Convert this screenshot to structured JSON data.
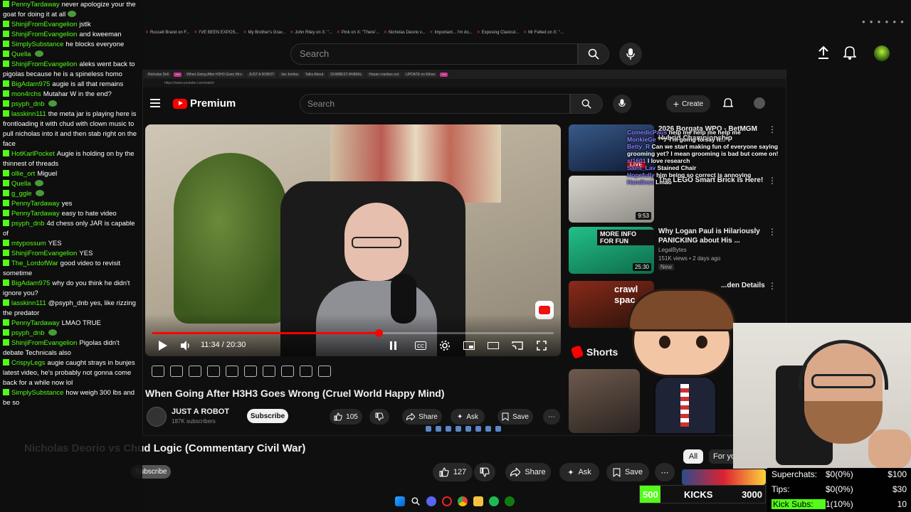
{
  "colors": {
    "kick_green": "#53fc18",
    "youtube_red": "#ff0000",
    "bg": "#0f0f0f"
  },
  "outer_browser": {
    "tabs": [
      "Russell Brand on F...",
      "I'VE BEEN EXPOS...",
      "My Brother's Grav...",
      "John Riley on X: \"...",
      "Pink on X: \"There'...",
      "Nicholas Deorio v...",
      "Important... I'm do...",
      "Exposing Clavicul...",
      "Mr Felted on X: \"..."
    ]
  },
  "outer_youtube": {
    "search_placeholder": "Search",
    "video_title": "Nicholas Deorio vs Chud Logic (Commentary Civil War)",
    "subscribe_label": "Subscribe",
    "like_count": "127",
    "share_label": "Share",
    "ask_label": "Ask",
    "save_label": "Save",
    "chips": [
      "All",
      "For yo"
    ]
  },
  "inner_youtube": {
    "logo_text": "Premium",
    "search_placeholder": "Search",
    "create_label": "Create",
    "time_display": "11:34 / 20:30",
    "progress": 0.5642,
    "video_title": "When Going After H3H3 Goes Wrong (Cruel World Happy Mind)",
    "channel_name": "JUST A ROBOT",
    "channel_subs": "187K subscribers",
    "subscribe_label": "Subscribe",
    "like_count": "105",
    "share_label": "Share",
    "ask_label": "Ask",
    "save_label": "Save",
    "shorts_label": "Shorts",
    "recommendations": [
      {
        "title": "2026 Borgata WPO - BetMGM Hybrid Championship",
        "badge": "LIVE",
        "meta": ""
      },
      {
        "title": "The LEGO Smart Brick Is Here!",
        "meta": "",
        "duration": "9:53"
      },
      {
        "title": "Why Logan Paul is Hilariously PANICKING about His ...",
        "channel": "LegalBytes",
        "meta": "151K views • 2 days ago",
        "badge": "New",
        "duration": "25:30",
        "thumb_text": "MORE INFO FOR FUN"
      },
      {
        "title": "...den Details",
        "thumb_text": "crawl spac"
      }
    ],
    "overlay_chat": [
      {
        "user": "ComedicPaus",
        "text": "help me help me help me"
      },
      {
        "user": "MonkieGe",
        "text": "\"*** I'm going to say it...\""
      },
      {
        "user": "Betty_R",
        "text": "Can we start making fun of everyone saying grooming yet? I mean grooming is bad but come on!"
      },
      {
        "user": "st1601",
        "text": "I love research"
      },
      {
        "user": "Saint_Lav",
        "text": "Stained Chair"
      },
      {
        "user": "Hopefully",
        "text": "him being so correct is annoying"
      },
      {
        "user": "Handlesa",
        "text": "Lmao"
      }
    ]
  },
  "chat": [
    {
      "user": "PennyTardaway",
      "text": "never apologize your the goat for doing it at all",
      "emote": true
    },
    {
      "user": "ShinjiFromEvangelion",
      "text": "jstlk"
    },
    {
      "user": "ShinjiFromEvangelion",
      "text": "and kweeman"
    },
    {
      "user": "SimplySubstance",
      "text": "he blocks everyone"
    },
    {
      "user": "Quella",
      "text": "",
      "emote": true
    },
    {
      "user": "ShinjiFromEvangelion",
      "text": "aleks went back to pigolas because he is a spineless homo"
    },
    {
      "user": "BigAdam975",
      "text": "augie is all that remains"
    },
    {
      "user": "mon4rchs",
      "text": "Mutahar W in the end?"
    },
    {
      "user": "psyph_dnb",
      "text": "",
      "emote": true
    },
    {
      "user": "lasskinn111",
      "text": "the meta jar is playing here is frontloading it with chud with clown music to pull nicholas into it and then stab right on the face"
    },
    {
      "user": "HotKarlPocket",
      "text": "Augie is holding on by the thinnest of threads"
    },
    {
      "user": "ollie_ort",
      "text": "Miguel"
    },
    {
      "user": "Quella",
      "text": "",
      "emote": true
    },
    {
      "user": "g_ggle",
      "text": "",
      "emote": true
    },
    {
      "user": "PennyTardaway",
      "text": "yes"
    },
    {
      "user": "PennyTardaway",
      "text": "easy to hate video"
    },
    {
      "user": "psyph_dnb",
      "text": "4d chess only JAR is capable of"
    },
    {
      "user": "mtypossum",
      "text": "YES"
    },
    {
      "user": "ShinjiFromEvangelion",
      "text": "YES"
    },
    {
      "user": "The_LordofWar",
      "text": "good video to revisit sometime"
    },
    {
      "user": "BigAdam975",
      "text": "why do you think he didn't ignore you?"
    },
    {
      "user": "lasskinn111",
      "text": "@psyph_dnb yes, like rizzing the predator"
    },
    {
      "user": "PennyTardaway",
      "text": "LMAO TRUE"
    },
    {
      "user": "psyph_dnb",
      "text": "",
      "emote": true
    },
    {
      "user": "ShinjiFromEvangelion",
      "text": "Pigolas didn't debate Technicals also"
    },
    {
      "user": "CrispyLegs",
      "text": "augie caught strays in bunjes latest video, he's probably not gonna come back for a while now lol"
    },
    {
      "user": "SimplySubstance",
      "text": "how weigh 300 lbs and be so"
    }
  ],
  "stats": {
    "superchats_label": "Superchats:",
    "superchats_value": "$0(0%)",
    "superchats_goal": "$100",
    "tips_label": "Tips:",
    "tips_value": "$0(0%)",
    "tips_goal": "$30",
    "kick_subs_label": "Kick Subs:",
    "kick_subs_value": "1(10%)",
    "kick_subs_goal": "10"
  },
  "kicks": {
    "left": "500",
    "label": "KICKS",
    "right": "3000",
    "progress": 0.1667
  },
  "icons": [
    "search-icon",
    "mic-icon",
    "upload-icon",
    "bell-icon",
    "menu-icon",
    "play-icon",
    "volume-icon",
    "settings-icon",
    "fullscreen-icon",
    "like-icon",
    "dislike-icon",
    "share-icon",
    "save-icon",
    "more-icon"
  ]
}
